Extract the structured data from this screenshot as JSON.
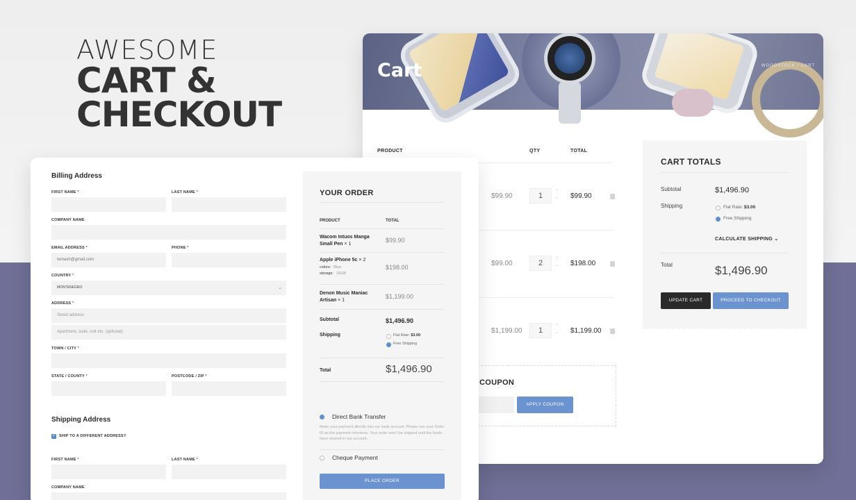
{
  "hero": {
    "line1": "AWESOME",
    "line2": "CART &",
    "line3": "CHECKOUT"
  },
  "cart": {
    "title": "Cart",
    "breadcrumb": "WOODSTOCK / CART",
    "headers": {
      "product": "PRODUCT",
      "qty": "QTY",
      "total": "TOTAL"
    },
    "rows": [
      {
        "price": "$99.90",
        "qty": "1",
        "total": "$99.90"
      },
      {
        "price": "$99.00",
        "qty": "2",
        "total": "$198.00"
      },
      {
        "price": "$1,199.00",
        "qty": "1",
        "total": "$1,199.00"
      }
    ],
    "coupon": {
      "title": "COUPON",
      "button": "APPLY COUPON"
    }
  },
  "cart_totals": {
    "title": "CART TOTALS",
    "subtotal_label": "Subtotal",
    "subtotal_value": "$1,496.90",
    "shipping_label": "Shipping",
    "flat_rate_label": "Flat Rate:",
    "flat_rate_value": "$3.00",
    "free_shipping": "Free Shipping",
    "calculate_shipping": "CALCULATE SHIPPING",
    "total_label": "Total",
    "total_value": "$1,496.90",
    "update_button": "UPDATE CART",
    "checkout_button": "PROCEED TO CHECKOUT"
  },
  "billing": {
    "title": "Billing Address",
    "first_name": "FIRST NAME",
    "last_name": "LAST NAME",
    "company": "COMPANY NAME",
    "email": "EMAIL ADDRESS",
    "email_value": "temash@gmail.com",
    "phone": "PHONE",
    "country": "COUNTRY",
    "country_value": "MONTENEGRO",
    "address": "ADDRESS",
    "street_placeholder": "Street address",
    "apartment_placeholder": "Apartment, suite, unit etc. (optional)",
    "town": "TOWN / CITY",
    "state": "STATE / COUNTY",
    "postcode": "POSTCODE / ZIP",
    "required": "*"
  },
  "shipping": {
    "title": "Shipping Address",
    "ship_different": "SHIP TO A DIFFERENT ADDRESS?",
    "first_name": "FIRST NAME",
    "last_name": "LAST NAME",
    "company": "COMPANY NAME"
  },
  "order": {
    "title": "YOUR ORDER",
    "header_product": "PRODUCT",
    "header_total": "TOTAL",
    "items": [
      {
        "name": "Wacom Intuos Manga Small Pen",
        "qty": "× 1",
        "price": "$99.90"
      },
      {
        "name": "Apple iPhone 5c",
        "qty": "× 2",
        "price": "$198.00",
        "colors_label": "colors:",
        "colors_value": "Blue",
        "storage_label": "storage:",
        "storage_value": "16GB"
      },
      {
        "name": "Denon Music Maniac Artisan",
        "qty": "× 1",
        "price": "$1,199.00"
      }
    ],
    "subtotal_label": "Subtotal",
    "subtotal_value": "$1,496.90",
    "shipping_label": "Shipping",
    "flat_rate_label": "Flat Rate:",
    "flat_rate_value": "$3.00",
    "free_shipping": "Free Shipping",
    "total_label": "Total",
    "total_value": "$1,496.90",
    "payment_bank": "Direct Bank Transfer",
    "payment_bank_desc": "Make your payment directly into our bank account. Please use your Order ID as the payment reference. Your order won't be shipped until the funds have cleared in our account.",
    "payment_cheque": "Cheque Payment",
    "place_order": "PLACE ORDER"
  },
  "colors": {
    "accent": "#6b93d0",
    "dark": "#2a2a2a",
    "backdrop": "#6f6f97"
  }
}
